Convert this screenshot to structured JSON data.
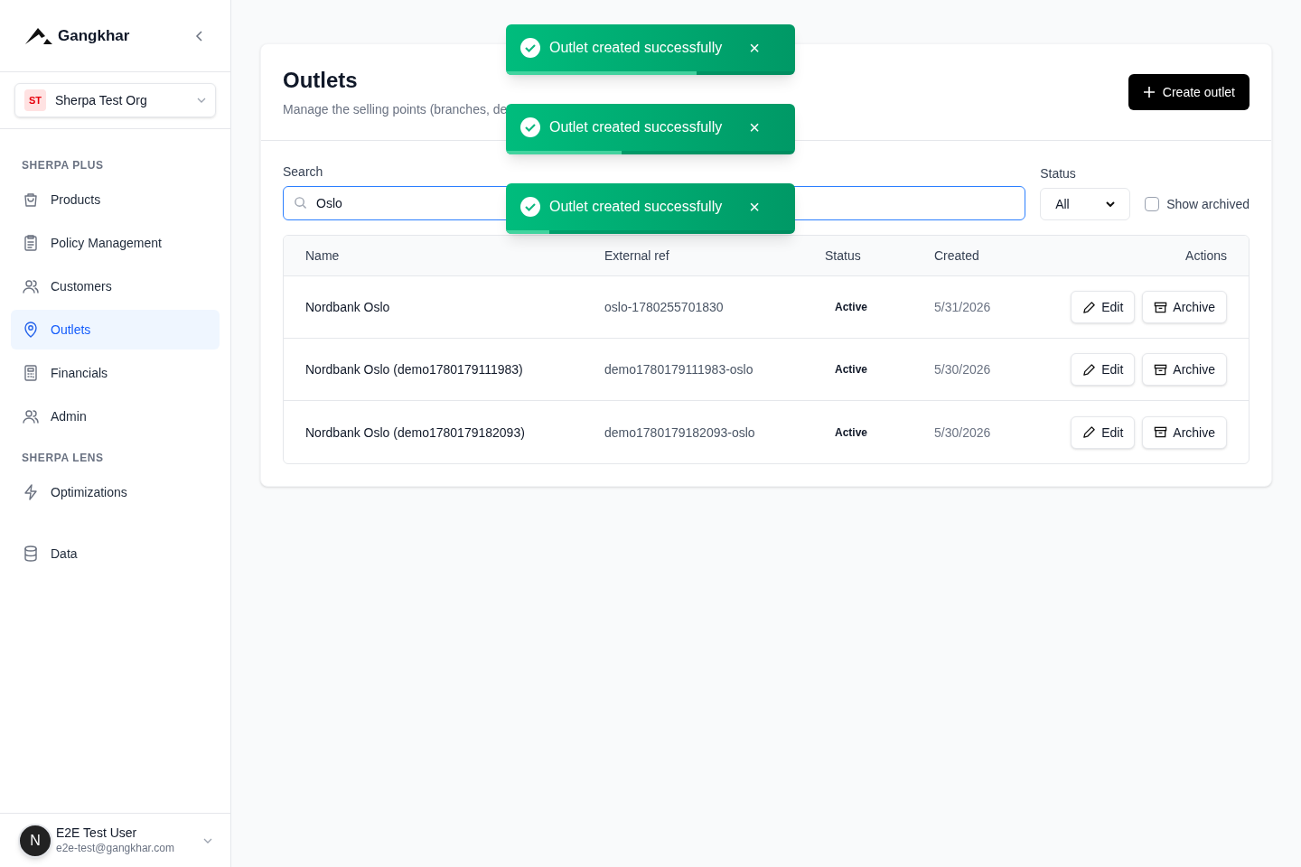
{
  "sidebar": {
    "brand": "Gangkhar",
    "org": {
      "initials": "ST",
      "name": "Sherpa Test Org"
    },
    "sections": [
      {
        "title": "SHERPA PLUS",
        "items": [
          {
            "label": "Products",
            "kind": "bag",
            "selected": false
          },
          {
            "label": "Policy Management",
            "kind": "clipboard",
            "selected": false
          },
          {
            "label": "Customers",
            "kind": "users",
            "selected": false
          },
          {
            "label": "Outlets",
            "kind": "pin",
            "selected": true
          },
          {
            "label": "Financials",
            "kind": "calculator",
            "selected": false
          },
          {
            "label": "Admin",
            "kind": "users",
            "selected": false
          }
        ]
      },
      {
        "title": "SHERPA LENS",
        "items": [
          {
            "label": "Optimizations",
            "kind": "zap",
            "selected": false
          }
        ]
      },
      {
        "items": [
          {
            "label": "Data",
            "kind": "database",
            "selected": false
          }
        ]
      }
    ],
    "user": {
      "initial": "N",
      "name": "E2E Test User",
      "email": "e2e-test@gangkhar.com"
    }
  },
  "page": {
    "title": "Outlets",
    "subtitle": "Manage the selling points (branches, de",
    "create_button": "Create outlet"
  },
  "filters": {
    "search_label": "Search",
    "search_value": "Oslo",
    "status_label": "Status",
    "status_value": "All",
    "show_archived": {
      "label": "Show archived",
      "checked": false
    }
  },
  "table": {
    "columns": [
      "Name",
      "External ref",
      "Status",
      "Created",
      "Actions"
    ],
    "rows": [
      {
        "name": "Nordbank Oslo",
        "external_ref": "oslo-1780255701830",
        "status": "Active",
        "created": "5/31/2026",
        "actions": [
          "Edit",
          "Archive"
        ]
      },
      {
        "name": "Nordbank Oslo (demo1780179111983)",
        "external_ref": "demo1780179111983-oslo",
        "status": "Active",
        "created": "5/30/2026",
        "actions": [
          "Edit",
          "Archive"
        ]
      },
      {
        "name": "Nordbank Oslo (demo1780179182093)",
        "external_ref": "demo1780179182093-oslo",
        "status": "Active",
        "created": "5/30/2026",
        "actions": [
          "Edit",
          "Archive"
        ]
      }
    ]
  },
  "toasts": [
    {
      "message": "Outlet created successfully",
      "close": "×",
      "level": 0.66
    },
    {
      "message": "Outlet created successfully",
      "close": "×",
      "level": 0.4
    },
    {
      "message": "Outlet created successfully",
      "close": "×",
      "level": 0.15
    }
  ]
}
